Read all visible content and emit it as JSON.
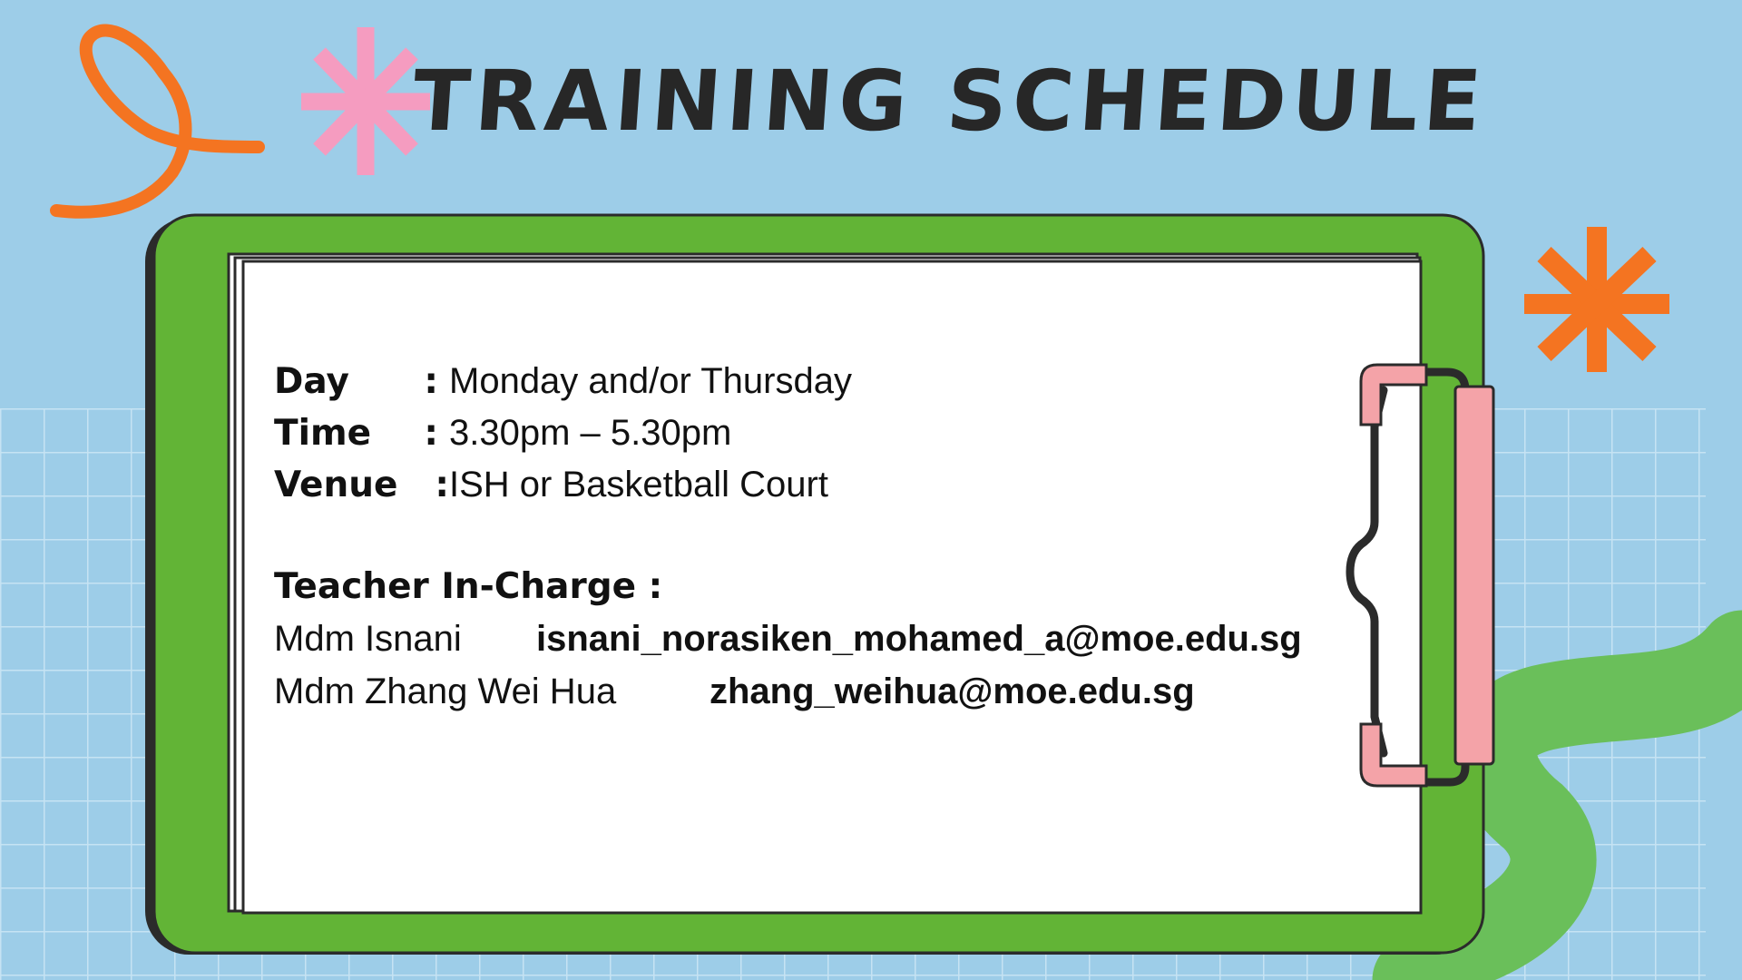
{
  "title": "TRAINING SCHEDULE",
  "schedule": [
    {
      "label": "Day",
      "colon": ":",
      "value": "Monday and/or Thursday"
    },
    {
      "label": "Time",
      "colon": ":",
      "value": "3.30pm – 5.30pm"
    },
    {
      "label": "Venue",
      "colon": ":",
      "value": "ISH or Basketball Court"
    }
  ],
  "teacher_heading": "Teacher In-Charge :",
  "teachers": [
    {
      "name": "Mdm Isnani",
      "email": "isnani_norasiken_mohamed_a@moe.edu.sg"
    },
    {
      "name": "Mdm Zhang Wei Hua",
      "email": "zhang_weihua@moe.edu.sg"
    }
  ],
  "colors": {
    "background": "#9dcde8",
    "clipboard": "#62b436",
    "paper": "#ffffff",
    "clip": "#f4a3a8",
    "orange_accent": "#f47421",
    "pink_accent": "#f59cc0",
    "wave": "#6abf5a"
  },
  "icons": [
    "orange-squiggle-icon",
    "pink-asterisk-icon",
    "orange-asterisk-icon",
    "clipboard-clip-icon",
    "green-wave-icon"
  ]
}
